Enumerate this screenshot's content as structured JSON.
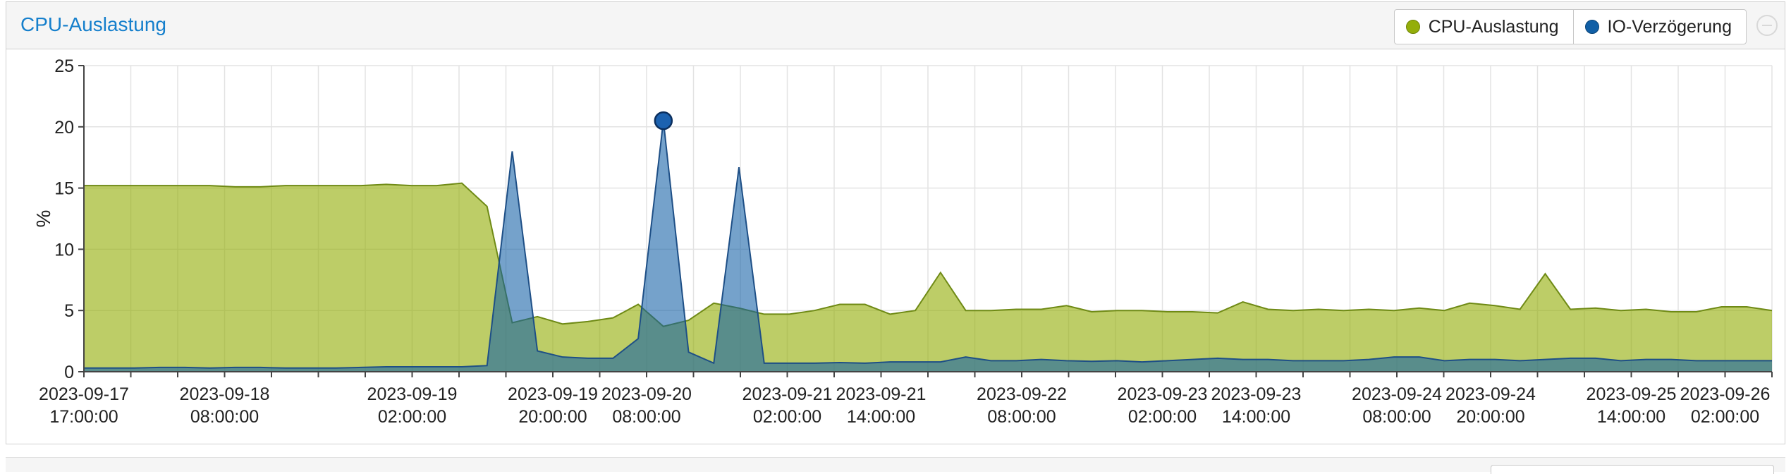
{
  "panel": {
    "title": "CPU-Auslastung"
  },
  "legend": {
    "items": [
      {
        "label": "CPU-Auslastung",
        "color": "#94ae0a"
      },
      {
        "label": "IO-Verzögerung",
        "color": "#115fa6"
      }
    ]
  },
  "chart_data": {
    "type": "area",
    "title": "CPU-Auslastung",
    "ylabel": "%",
    "ylim": [
      0,
      25
    ],
    "yticks": [
      0,
      5,
      10,
      15,
      20,
      25
    ],
    "grid": true,
    "legend_position": "top-right",
    "x_tick_labels": [
      [
        "2023-09-17",
        "17:00:00"
      ],
      [
        "2023-09-18",
        "08:00:00"
      ],
      [
        "2023-09-19",
        "02:00:00"
      ],
      [
        "2023-09-19",
        "20:00:00"
      ],
      [
        "2023-09-20",
        "08:00:00"
      ],
      [
        "2023-09-21",
        "02:00:00"
      ],
      [
        "2023-09-21",
        "14:00:00"
      ],
      [
        "2023-09-22",
        "08:00:00"
      ],
      [
        "2023-09-23",
        "02:00:00"
      ],
      [
        "2023-09-23",
        "14:00:00"
      ],
      [
        "2023-09-24",
        "08:00:00"
      ],
      [
        "2023-09-24",
        "20:00:00"
      ],
      [
        "2023-09-25",
        "14:00:00"
      ],
      [
        "2023-09-26",
        "02:00:00"
      ]
    ],
    "x_tick_slots": [
      0,
      3,
      7,
      10,
      12,
      15,
      17,
      20,
      23,
      25,
      28,
      30,
      33,
      35
    ],
    "slot_count": 36,
    "series": [
      {
        "name": "CPU-Auslastung",
        "color": "#94ae0a",
        "values": [
          15.2,
          15.2,
          15.2,
          15.2,
          15.2,
          15.2,
          15.1,
          15.1,
          15.2,
          15.2,
          15.2,
          15.2,
          15.3,
          15.2,
          15.2,
          15.4,
          13.5,
          4.0,
          4.5,
          3.9,
          4.1,
          4.4,
          5.5,
          3.7,
          4.2,
          5.6,
          5.2,
          4.7,
          4.7,
          5.0,
          5.5,
          5.5,
          4.7,
          5.0,
          8.1,
          5.0,
          5.0,
          5.1,
          5.1,
          5.4,
          4.9,
          5.0,
          5.0,
          4.9,
          4.9,
          4.8,
          5.7,
          5.1,
          5.0,
          5.1,
          5.0,
          5.1,
          5.0,
          5.2,
          5.0,
          5.6,
          5.4,
          5.1,
          8.0,
          5.1,
          5.2,
          5.0,
          5.1,
          4.9,
          4.9,
          5.3,
          5.3,
          5.0
        ]
      },
      {
        "name": "IO-Verzögerung",
        "color": "#115fa6",
        "values": [
          0.3,
          0.3,
          0.3,
          0.35,
          0.35,
          0.3,
          0.35,
          0.35,
          0.3,
          0.3,
          0.3,
          0.35,
          0.4,
          0.4,
          0.4,
          0.4,
          0.5,
          18.0,
          1.7,
          1.2,
          1.1,
          1.1,
          2.7,
          20.5,
          1.6,
          0.7,
          16.7,
          0.7,
          0.7,
          0.7,
          0.75,
          0.7,
          0.8,
          0.8,
          0.8,
          1.2,
          0.9,
          0.9,
          1.0,
          0.9,
          0.85,
          0.9,
          0.8,
          0.9,
          1.0,
          1.1,
          1.0,
          1.0,
          0.9,
          0.9,
          0.9,
          1.0,
          1.2,
          1.2,
          0.9,
          1.0,
          1.0,
          0.9,
          1.0,
          1.1,
          1.1,
          0.9,
          1.0,
          1.0,
          0.9,
          0.9,
          0.9,
          0.9
        ]
      }
    ],
    "highlight": {
      "series": 1,
      "index": 23
    }
  }
}
